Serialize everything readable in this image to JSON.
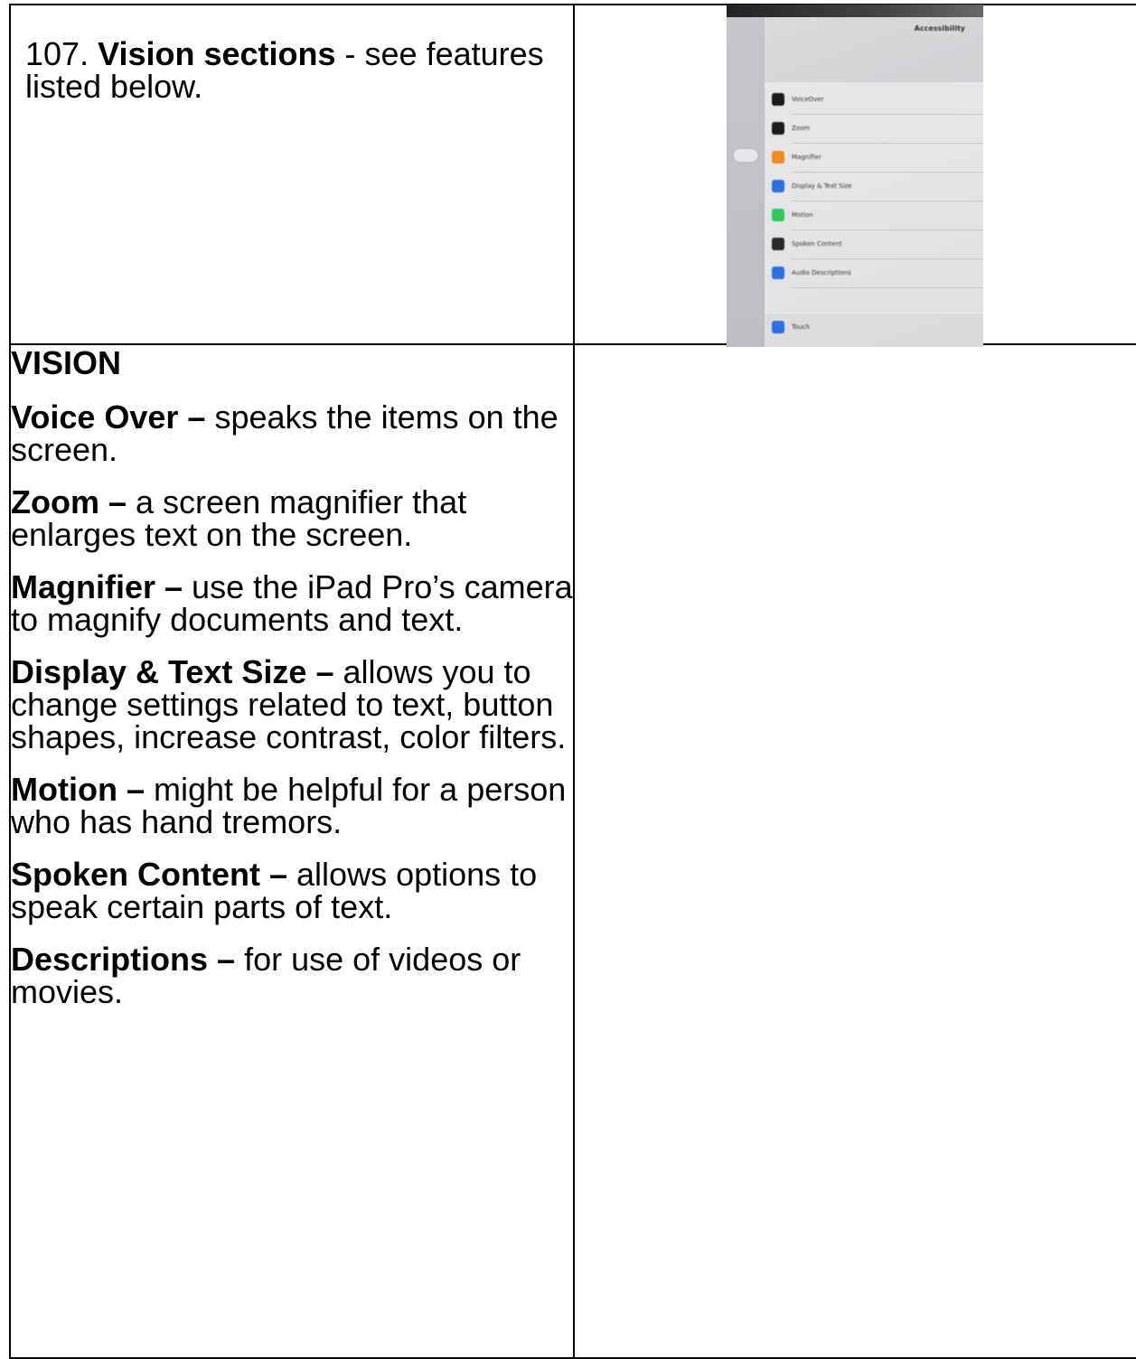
{
  "intro": {
    "number": "107.",
    "bold": "Vision sections",
    "rest": " - see features listed below."
  },
  "vision": {
    "heading": "VISION",
    "features": [
      {
        "name": "Voice Over –",
        "desc": " speaks the items on the screen."
      },
      {
        "name": "Zoom –",
        "desc": " a screen magnifier that enlarges text on the screen."
      },
      {
        "name": "Magnifier –",
        "desc": " use the iPad Pro’s camera to magnify documents and text."
      },
      {
        "name": "Display & Text Size –",
        "desc": " allows you to change settings related to text, button shapes, increase contrast, color filters."
      },
      {
        "name": "Motion –",
        "desc": " might be helpful for a person who has hand tremors."
      },
      {
        "name": "Spoken Content –",
        "desc": " allows options to speak certain parts of text."
      },
      {
        "name": "Descriptions –",
        "desc": " for use of videos or movies."
      }
    ]
  },
  "photo": {
    "title": "Accessibility",
    "items": [
      {
        "label": "VoiceOver",
        "color": "#1c1c1e",
        "icon": "voiceover-icon"
      },
      {
        "label": "Zoom",
        "color": "#1c1c1e",
        "icon": "zoom-icon"
      },
      {
        "label": "Magnifier",
        "color": "#f08a24",
        "icon": "magnifier-icon"
      },
      {
        "label": "Display & Text Size",
        "color": "#2f6fe0",
        "icon": "display-text-icon"
      },
      {
        "label": "Motion",
        "color": "#34c759",
        "icon": "motion-icon"
      },
      {
        "label": "Spoken Content",
        "color": "#2b2b2e",
        "icon": "spoken-content-icon"
      },
      {
        "label": "Audio Descriptions",
        "color": "#2f6fe0",
        "icon": "audio-descriptions-icon"
      },
      {
        "label": "Touch",
        "color": "#2f6fe0",
        "icon": "touch-icon"
      }
    ]
  }
}
